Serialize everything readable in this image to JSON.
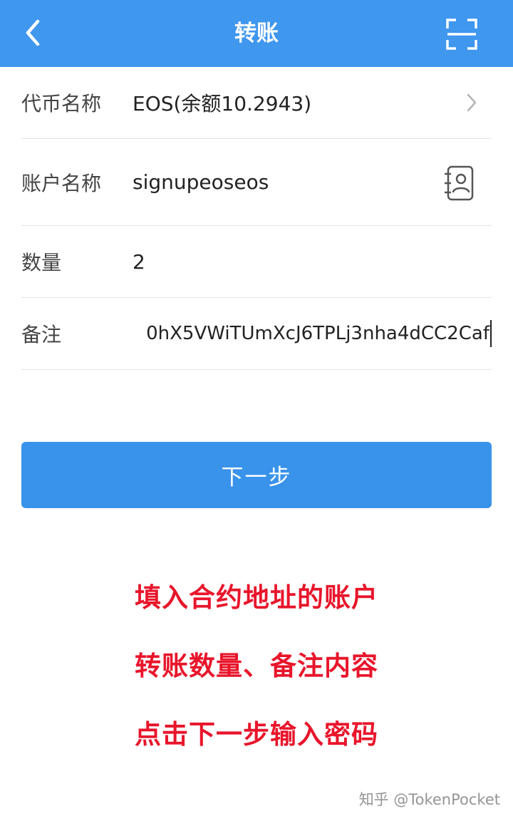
{
  "header": {
    "title": "转账",
    "back_icon": "chevron-left-icon",
    "scan_icon": "scan-icon",
    "background": "#3f97ee"
  },
  "form": {
    "token": {
      "label": "代币名称",
      "value": "EOS(余额10.2943)"
    },
    "account": {
      "label": "账户名称",
      "value": "signupeoseos"
    },
    "amount": {
      "label": "数量",
      "value": "2"
    },
    "memo": {
      "label": "备注",
      "value": "0hX5VWiTUmXcJ6TPLj3nha4dCC2Caf"
    }
  },
  "next_button": {
    "label": "下一步",
    "color": "#3a93ea"
  },
  "annotations": {
    "line1": "填入合约地址的账户",
    "line2": "转账数量、备注内容",
    "line3": "点击下一步输入密码",
    "color": "#e8152b"
  },
  "watermark": "知乎 @TokenPocket"
}
